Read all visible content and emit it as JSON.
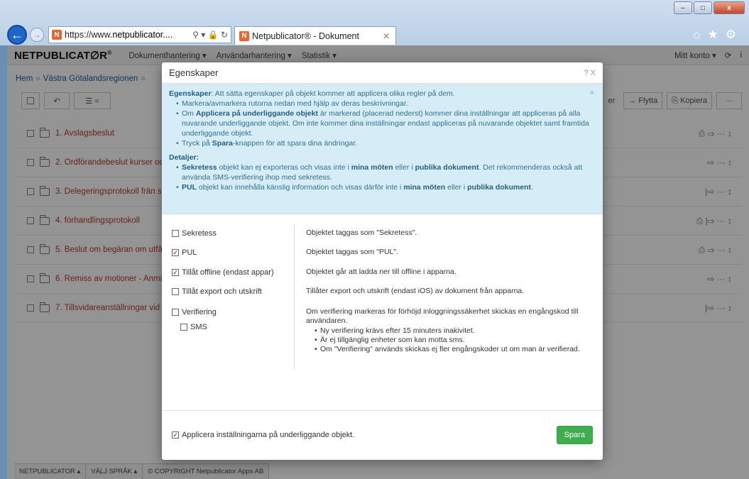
{
  "browser": {
    "url_prefix": "https://www.",
    "url_domain": "netpublicator....",
    "tab_title": "Netpublicator® - Dokument",
    "window_buttons": [
      "–",
      "□",
      "x"
    ]
  },
  "app": {
    "logo_bold": "NETPUBLICAT∅R",
    "logo_reg": "®",
    "nav": [
      "Dokumenthantering ▾",
      "Användarhantering ▾",
      "Statistik ▾"
    ],
    "account": "Mitt konto ▾",
    "breadcrumb": [
      "Hem",
      "Västra Götalandsregionen"
    ],
    "toolbar_right": [
      "er",
      "→ Flytta",
      "⎘ Kopiera",
      "···"
    ],
    "rows": [
      {
        "label": "1. Avslagsbeslut",
        "icons": "⎙  ⇨  ···  ↕"
      },
      {
        "label": "2. Ordförandebeslut kurser oc",
        "icons": "⇨  ···  ↕"
      },
      {
        "label": "3. Delegeringsprotokoll från st",
        "icons": "|⇨  ···  ↕"
      },
      {
        "label": "4. förhandlingsprotokoll",
        "icons": "⎙  |⇨  ···  ↕"
      },
      {
        "label": "5. Beslut om begäran om utfå",
        "icons": "⎙  ⇨  ···  ↕"
      },
      {
        "label": "6. Remiss av motioner - Anmä",
        "icons": "⇨  ···  ↕"
      },
      {
        "label": "7. Tillsvidareanställningar vid",
        "icons": "|⇨  ···  ↕"
      }
    ],
    "footer": [
      "NETPUBLICATOR ▴",
      "VÄLJ SPRÅK ▴",
      "© COPYRIGHT Netpublicator Apps AB"
    ]
  },
  "modal": {
    "title": "Egenskaper",
    "head_icons": "? X",
    "info": {
      "lead_bold": "Egenskaper",
      "lead_text": ": Att sätta egenskaper på objekt kommer att applicera olika regler på dem.",
      "b1": "Markera/avmarkera rutorna nedan med hjälp av deras beskrivningar.",
      "b2_pre": "Om ",
      "b2_bold": "Applicera på underliggande objekt",
      "b2_post": " är markerad (placerad nederst) kommer dina inställningar att appliceras på alla nuvarande underliggande objekt. Om inte kommer dina inställningar endast appliceras på nuvarande objektet samt framtida underliggande objekt.",
      "b3_pre": "Tryck på ",
      "b3_bold": "Spara",
      "b3_post": "-knappen för att spara dina ändringar.",
      "details_title": "Detaljer:",
      "d1_bold": "Sekretess",
      "d1_text_a": " objekt kan ej exporteras och visas inte i ",
      "d1_bold2": "mina möten",
      "d1_text_b": " eller i ",
      "d1_bold3": "publika dokument",
      "d1_text_c": ". Det rekommenderas också att använda SMS-verifiering ihop med sekretess.",
      "d2_bold": "PUL",
      "d2_text_a": " objekt kan innehålla känslig information och visas därför inte i ",
      "d2_bold2": "mina möten",
      "d2_text_b": " eller i ",
      "d2_bold3": "publika dokument",
      "d2_text_c": "."
    },
    "options": [
      {
        "label": "Sekretess",
        "checked": false,
        "desc": "Objektet taggas som \"Sekretess\"."
      },
      {
        "label": "PUL",
        "checked": true,
        "desc": "Objektet taggas som \"PUL\"."
      },
      {
        "label": "Tillåt offline (endast appar)",
        "checked": true,
        "desc": "Objektet går att ladda ner till offline i apparna."
      },
      {
        "label": "Tillåt export och utskrift",
        "checked": false,
        "desc": "Tillåter export och utskrift (endast iOS) av dokument från apparna."
      },
      {
        "label": "Verifiering",
        "checked": false,
        "desc": "Om verifiering markeras för förhöjd inloggningssäkerhet skickas en engångskod till användaren."
      },
      {
        "label": "SMS",
        "checked": false
      }
    ],
    "verify_bullets": [
      "Ny verifiering krävs efter 15 minuters inakivitet.",
      "Är ej tillgänglig enheter som kan motta sms.",
      "Om \"Verifiering\" används skickas ej fler engångskoder ut om man är verifierad."
    ],
    "apply_label": "Applicera inställningarna på underliggande objekt.",
    "apply_checked": true,
    "save_label": "Spara"
  }
}
